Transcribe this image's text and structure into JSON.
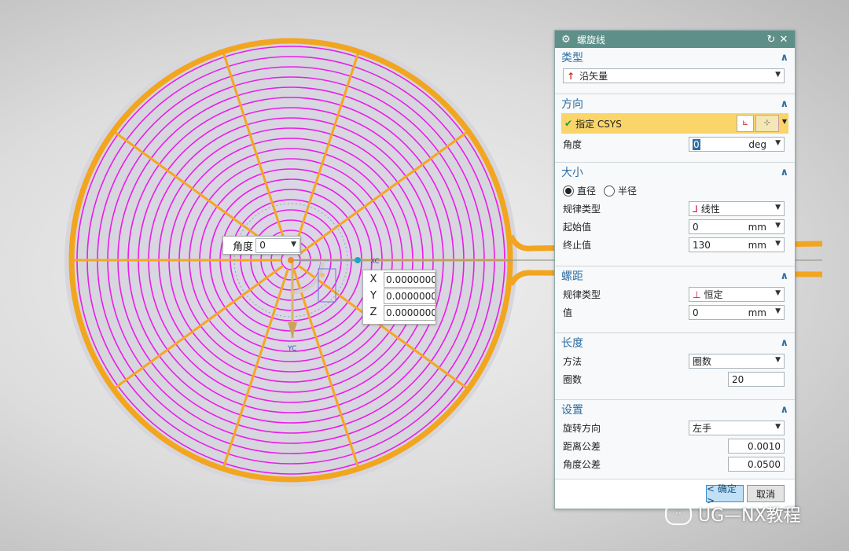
{
  "dialog": {
    "title": "螺旋线",
    "type_section": {
      "label": "类型",
      "value": "沿矢量"
    },
    "direction_section": {
      "label": "方向",
      "csys_label": "指定 CSYS",
      "angle_label": "角度",
      "angle_value": "0",
      "angle_unit": "deg"
    },
    "size_section": {
      "label": "大小",
      "diameter_label": "直径",
      "radius_label": "半径",
      "law_type_label": "规律类型",
      "law_type_value": "线性",
      "start_label": "起始值",
      "start_value": "0",
      "start_unit": "mm",
      "end_label": "终止值",
      "end_value": "130",
      "end_unit": "mm"
    },
    "pitch_section": {
      "label": "螺距",
      "law_type_label": "规律类型",
      "law_type_value": "恒定",
      "value_label": "值",
      "value": "0",
      "unit": "mm"
    },
    "length_section": {
      "label": "长度",
      "method_label": "方法",
      "method_value": "圈数",
      "turns_label": "圈数",
      "turns_value": "20"
    },
    "settings_section": {
      "label": "设置",
      "rotation_label": "旋转方向",
      "rotation_value": "左手",
      "dist_tol_label": "距离公差",
      "dist_tol_value": "0.0010",
      "angle_tol_label": "角度公差",
      "angle_tol_value": "0.0500"
    },
    "ok_label": "< 确定 >",
    "cancel_label": "取消"
  },
  "viewport": {
    "angle_popup_label": "角度",
    "angle_popup_value": "0",
    "coords": [
      {
        "axis": "X",
        "value": "0.0000000"
      },
      {
        "axis": "Y",
        "value": "0.0000000"
      },
      {
        "axis": "Z",
        "value": "0.0000000"
      }
    ],
    "axis_label_x": "XC",
    "axis_label_y": "YC"
  },
  "watermark": "UG—NX教程",
  "colors": {
    "spiral": "#e81ee8",
    "frame": "#f5a623",
    "accent": "#2f6ea3",
    "titlebar": "#5e8f88"
  }
}
